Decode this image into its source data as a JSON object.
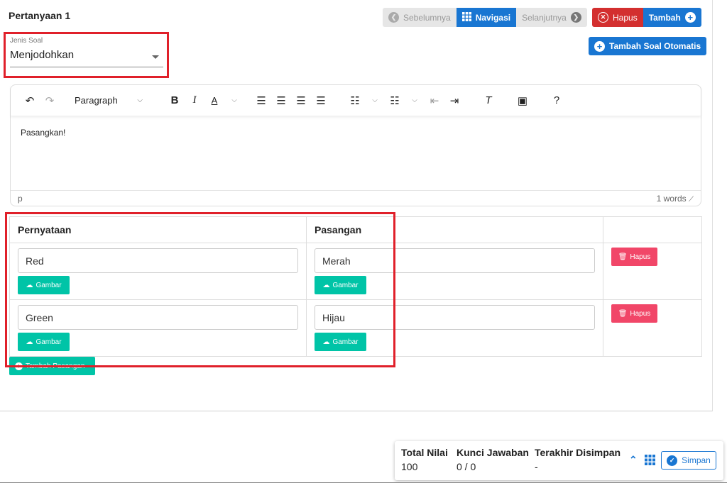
{
  "question": {
    "title": "Pertanyaan 1"
  },
  "nav": {
    "prev": "Sebelumnya",
    "navigate": "Navigasi",
    "next": "Selanjutnya",
    "delete": "Hapus",
    "add": "Tambah",
    "auto_add": "Tambah Soal Otomatis"
  },
  "jenis": {
    "label": "Jenis Soal",
    "value": "Menjodohkan"
  },
  "editor": {
    "paragraph_select": "Paragraph",
    "content": "Pasangkan!",
    "status_path": "p",
    "word_count": "1 words"
  },
  "table": {
    "headers": [
      "Pernyataan",
      "Pasangan"
    ],
    "rows": [
      {
        "statement": "Red",
        "pair": "Merah"
      },
      {
        "statement": "Green",
        "pair": "Hijau"
      }
    ],
    "image_btn": "Gambar",
    "delete_btn": "Hapus",
    "add_pair": "Tambah Pasangan"
  },
  "footer": {
    "total_label": "Total Nilai",
    "total_value": "100",
    "key_label": "Kunci Jawaban",
    "key_value": "0 / 0",
    "saved_label": "Terakhir Disimpan",
    "saved_value": "-",
    "save_btn": "Simpan"
  },
  "colors": {
    "primary": "#1976d2",
    "danger": "#d32f2f",
    "teal": "#00c4a7",
    "pink": "#f14668",
    "highlight": "#e0202a"
  }
}
